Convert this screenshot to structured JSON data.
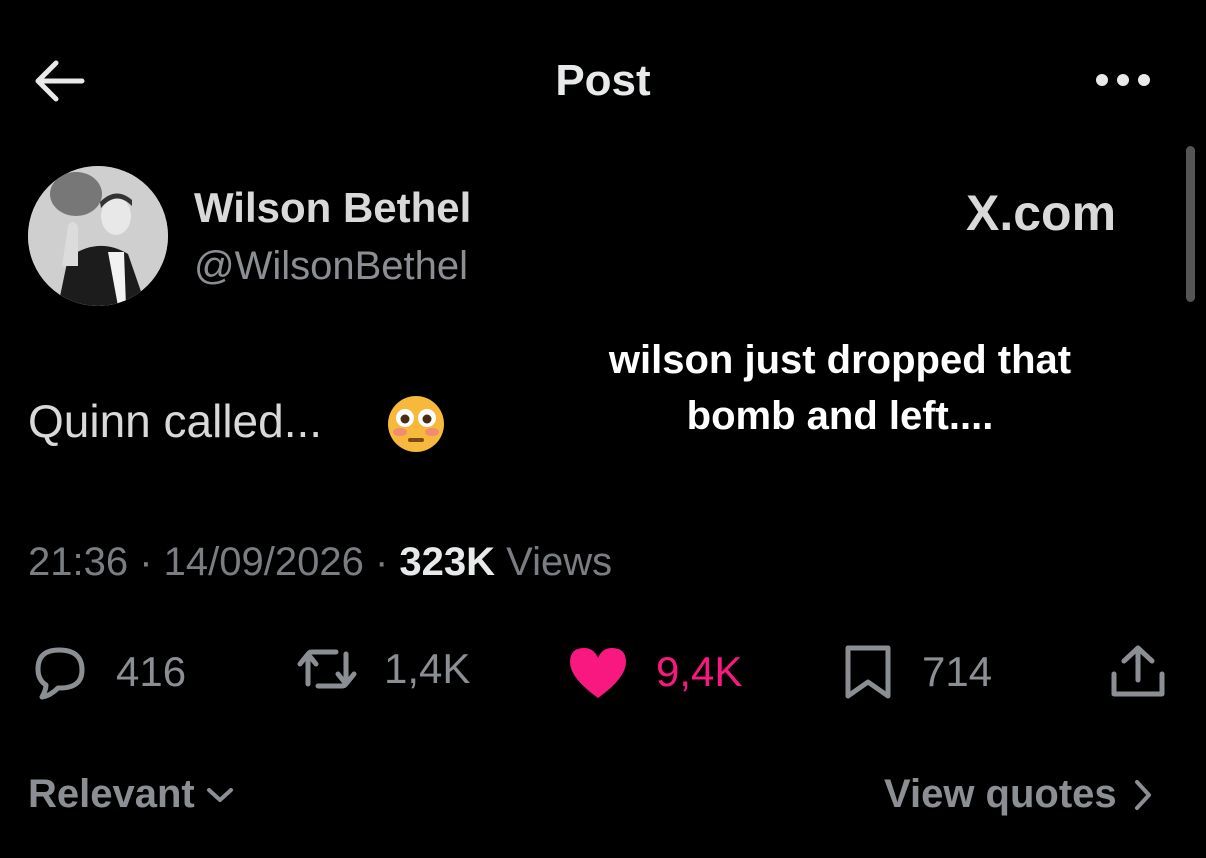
{
  "header": {
    "title": "Post",
    "back_icon": "arrow-left-icon",
    "more_icon": "more-horizontal-icon"
  },
  "author": {
    "name": "Wilson Bethel",
    "handle": "@WilsonBethel",
    "avatar_icon": "profile-photo"
  },
  "watermark": "X.com",
  "overlay_caption": "wilson just dropped that bomb and left....",
  "post": {
    "text": "Quinn called...",
    "emoji": "flushed-face-emoji"
  },
  "meta": {
    "time": "21:36",
    "date": "14/09/2026",
    "views_count": "323K",
    "views_label": "Views",
    "separator": " · "
  },
  "actions": {
    "replies": "416",
    "reposts": "1,4K",
    "likes": "9,4K",
    "bookmarks": "714",
    "like_color": "#f91880"
  },
  "footer": {
    "sort_label": "Relevant",
    "view_quotes_label": "View quotes"
  }
}
